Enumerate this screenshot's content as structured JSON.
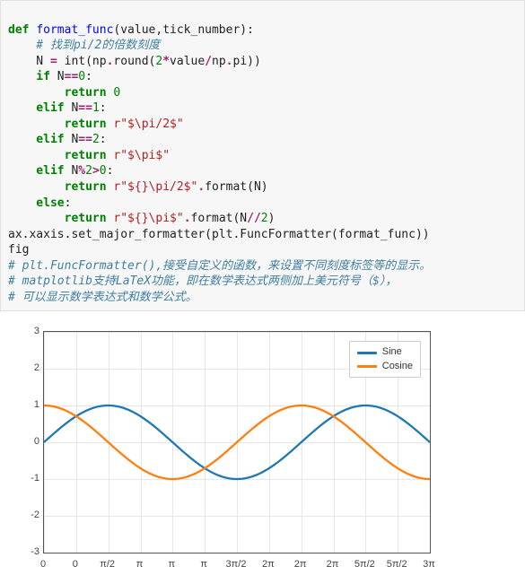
{
  "code": {
    "l1a": "def ",
    "l1b": "format_func",
    "l1c": "(value,tick_number):",
    "l2": "    # 找到pi/2的倍数刻度",
    "l3a": "    N ",
    "l3b": "=",
    "l3c": " int(np",
    "l3d": ".",
    "l3e": "round(",
    "l3f": "2",
    "l3g": "*",
    "l3h": "value",
    "l3i": "/",
    "l3j": "np",
    "l3k": ".",
    "l3l": "pi))",
    "l4a": "    if ",
    "l4b": "N",
    "l4c": "==",
    "l4d": "0",
    "l4e": ":",
    "l5a": "        return ",
    "l5b": "0",
    "l6a": "    elif ",
    "l6b": "N",
    "l6c": "==",
    "l6d": "1",
    "l6e": ":",
    "l7a": "        return ",
    "l7b": "r\"$\\pi/2$\"",
    "l8a": "    elif ",
    "l8b": "N",
    "l8c": "==",
    "l8d": "2",
    "l8e": ":",
    "l9a": "        return ",
    "l9b": "r\"$\\pi$\"",
    "l10a": "    elif ",
    "l10b": "N",
    "l10c": "%",
    "l10d": "2",
    "l10e": ">",
    "l10f": "0",
    "l10g": ":",
    "l11a": "        return ",
    "l11b": "r\"${}\\pi/2$\"",
    "l11c": ".",
    "l11d": "format(N)",
    "l12a": "    else",
    "l12b": ":",
    "l13a": "        return ",
    "l13b": "r\"${}\\pi$\"",
    "l13c": ".",
    "l13d": "format(N",
    "l13e": "//",
    "l13f": "2",
    "l13g": ")",
    "l14": "ax.xaxis.set_major_formatter(plt.FuncFormatter(format_func))",
    "l15": "fig",
    "l16": "# plt.FuncFormatter(),接受自定义的函数，来设置不同刻度标签等的显示。",
    "l17": "# matplotlib支持LaTeX功能，即在数学表达式两侧加上美元符号（$），",
    "l18": "# 可以显示数学表达式和数学公式。"
  },
  "chart_data": {
    "type": "line",
    "title": "",
    "xlabel": "",
    "ylabel": "",
    "xlim": [
      0,
      9.4248
    ],
    "ylim": [
      -3,
      3
    ],
    "grid": true,
    "x_ticks_values": [
      0,
      0.7854,
      1.5708,
      2.3562,
      3.1416,
      3.927,
      4.7124,
      5.4978,
      6.2832,
      7.0686,
      7.854,
      8.6394,
      9.4248
    ],
    "x_ticks_labels": [
      "0",
      "0",
      "π/2",
      "π",
      "π",
      "π",
      "3π/2",
      "2π",
      "2π",
      "2π",
      "5π/2",
      "5π/2",
      "3π"
    ],
    "y_ticks": [
      -3,
      -2,
      -1,
      0,
      1,
      2,
      3
    ],
    "series": [
      {
        "name": "Sine",
        "color": "#1f77b4",
        "func": "sin"
      },
      {
        "name": "Cosine",
        "color": "#ff7f0e",
        "func": "cos"
      }
    ],
    "legend_position": "upper right",
    "colors": {
      "sine": "#1f77b4",
      "cosine": "#ff7f0e"
    }
  }
}
